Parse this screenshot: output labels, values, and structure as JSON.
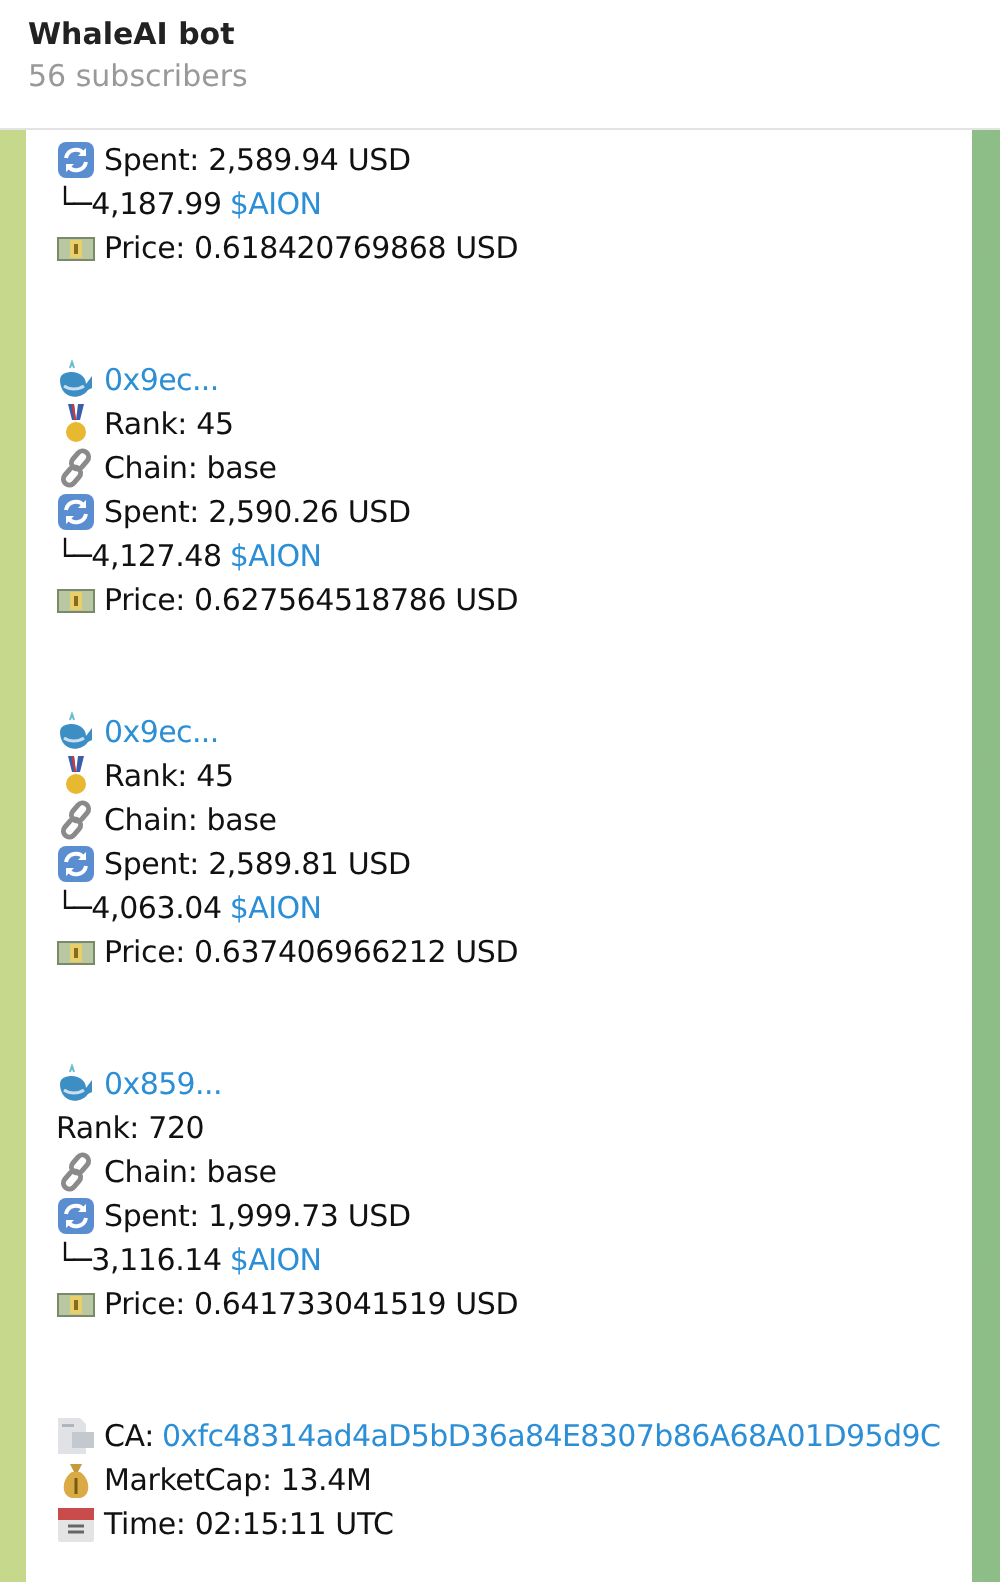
{
  "header": {
    "title": "WhaleAI bot",
    "subtitle": "56 subscribers"
  },
  "blocks": [
    {
      "lines": [
        {
          "kind": "refresh",
          "text": "Spent: 2,589.94 USD"
        },
        {
          "kind": "sub",
          "text": "└─4,187.99 ",
          "link": "$AION"
        },
        {
          "kind": "banknote",
          "text": "Price: 0.618420769868 USD"
        }
      ]
    },
    {
      "lines": [
        {
          "kind": "whale",
          "link": "0x9ec..."
        },
        {
          "kind": "medal",
          "text": "Rank: 45"
        },
        {
          "kind": "chain",
          "text": "Chain: base"
        },
        {
          "kind": "refresh",
          "text": "Spent: 2,590.26 USD"
        },
        {
          "kind": "sub",
          "text": "└─4,127.48 ",
          "link": "$AION"
        },
        {
          "kind": "banknote",
          "text": "Price: 0.627564518786 USD"
        }
      ]
    },
    {
      "lines": [
        {
          "kind": "whale",
          "link": "0x9ec..."
        },
        {
          "kind": "medal",
          "text": "Rank: 45"
        },
        {
          "kind": "chain",
          "text": "Chain: base"
        },
        {
          "kind": "refresh",
          "text": "Spent: 2,589.81 USD"
        },
        {
          "kind": "sub",
          "text": "└─4,063.04 ",
          "link": "$AION"
        },
        {
          "kind": "banknote",
          "text": "Price: 0.637406966212 USD"
        }
      ]
    },
    {
      "lines": [
        {
          "kind": "whale",
          "link": "0x859..."
        },
        {
          "kind": "plain",
          "text": "Rank: 720"
        },
        {
          "kind": "chain",
          "text": "Chain: base"
        },
        {
          "kind": "refresh",
          "text": "Spent: 1,999.73 USD"
        },
        {
          "kind": "sub",
          "text": "└─3,116.14 ",
          "link": "$AION"
        },
        {
          "kind": "banknote",
          "text": "Price: 0.641733041519 USD"
        }
      ]
    },
    {
      "lines": [
        {
          "kind": "document",
          "text": "CA: ",
          "link": "0xfc48314ad4aD5bD36a84E8307b86A68A01D95d9C"
        },
        {
          "kind": "moneybag",
          "text": "MarketCap: 13.4M"
        },
        {
          "kind": "calendar",
          "text": "Time: 02:15:11 UTC"
        }
      ]
    }
  ]
}
